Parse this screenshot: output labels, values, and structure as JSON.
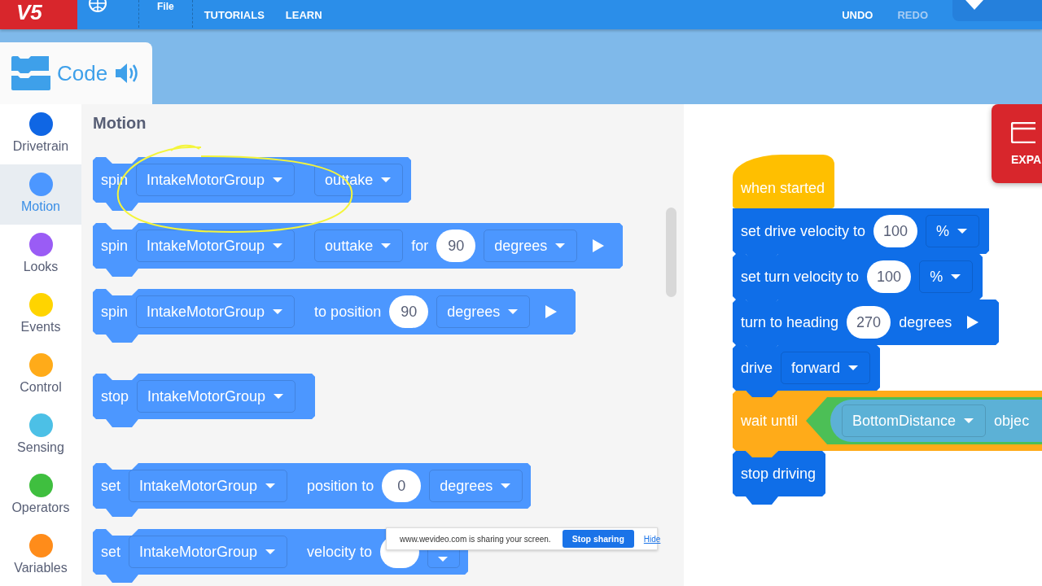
{
  "top_bar": {
    "logo": "V5",
    "file": "File",
    "menu": [
      {
        "label": "TUTORIALS"
      },
      {
        "label": "LEARN"
      }
    ],
    "undo": {
      "label": "UNDO",
      "disabled": false
    },
    "redo": {
      "label": "REDO",
      "disabled": true
    }
  },
  "code_tab": {
    "label": "Code"
  },
  "categories": [
    {
      "label": "Drivetrain",
      "color": "#0f66e4",
      "selected": false
    },
    {
      "label": "Motion",
      "color": "#4c97ff",
      "selected": true
    },
    {
      "label": "Looks",
      "color": "#9a5cf5",
      "selected": false
    },
    {
      "label": "Events",
      "color": "#ffd400",
      "selected": false
    },
    {
      "label": "Control",
      "color": "#ffab19",
      "selected": false
    },
    {
      "label": "Sensing",
      "color": "#4cc0e6",
      "selected": false
    },
    {
      "label": "Operators",
      "color": "#3fbf3f",
      "selected": false
    },
    {
      "label": "Variables",
      "color": "#ff8c1a",
      "selected": false
    }
  ],
  "palette": {
    "heading": "Motion",
    "groups": [
      [
        {
          "kind": "stack",
          "color": "#4c97ff",
          "parts": [
            {
              "kind": "text",
              "text": "spin"
            },
            {
              "kind": "dropdown",
              "text": "IntakeMotorGroup"
            },
            {
              "kind": "dropdown",
              "text": "outtake"
            }
          ]
        },
        {
          "kind": "stack",
          "color": "#4c97ff",
          "parts": [
            {
              "kind": "text",
              "text": "spin"
            },
            {
              "kind": "dropdown",
              "text": "IntakeMotorGroup"
            },
            {
              "kind": "dropdown",
              "text": "outtake"
            },
            {
              "kind": "text",
              "text": "for"
            },
            {
              "kind": "number",
              "text": "90"
            },
            {
              "kind": "dropdown",
              "text": "degrees"
            },
            {
              "kind": "run"
            }
          ]
        },
        {
          "kind": "stack",
          "color": "#4c97ff",
          "parts": [
            {
              "kind": "text",
              "text": "spin"
            },
            {
              "kind": "dropdown",
              "text": "IntakeMotorGroup"
            },
            {
              "kind": "text",
              "text": "to position"
            },
            {
              "kind": "number",
              "text": "90"
            },
            {
              "kind": "dropdown",
              "text": "degrees"
            },
            {
              "kind": "run"
            }
          ]
        }
      ],
      [
        {
          "kind": "stack",
          "color": "#4c97ff",
          "parts": [
            {
              "kind": "text",
              "text": "stop"
            },
            {
              "kind": "dropdown",
              "text": "IntakeMotorGroup"
            }
          ]
        }
      ],
      [
        {
          "kind": "stack",
          "color": "#4c97ff",
          "parts": [
            {
              "kind": "text",
              "text": "set"
            },
            {
              "kind": "dropdown",
              "text": "IntakeMotorGroup"
            },
            {
              "kind": "text",
              "text": "position to"
            },
            {
              "kind": "number",
              "text": "0"
            },
            {
              "kind": "dropdown",
              "text": "degrees"
            }
          ]
        },
        {
          "kind": "stack",
          "color": "#4c97ff",
          "parts": [
            {
              "kind": "text",
              "text": "set"
            },
            {
              "kind": "dropdown",
              "text": "IntakeMotorGroup"
            },
            {
              "kind": "text",
              "text": "velocity to"
            },
            {
              "kind": "number"
            },
            {
              "kind": "dropdown"
            }
          ]
        }
      ]
    ]
  },
  "annotations": [
    {
      "kind": "loop"
    }
  ],
  "workspace": {
    "script": [
      {
        "kind": "hat",
        "color": "#ffbf00",
        "parts": [
          {
            "kind": "text",
            "text": "when started"
          }
        ]
      },
      {
        "kind": "stack",
        "color": "#0f6ee8",
        "parts": [
          {
            "kind": "text",
            "text": "set drive velocity to"
          },
          {
            "kind": "number",
            "text": "100"
          },
          {
            "kind": "dropdown",
            "text": "%"
          }
        ]
      },
      {
        "kind": "stack",
        "color": "#0f6ee8",
        "parts": [
          {
            "kind": "text",
            "text": "set turn velocity to"
          },
          {
            "kind": "number",
            "text": "100"
          },
          {
            "kind": "dropdown",
            "text": "%"
          }
        ]
      },
      {
        "kind": "stack",
        "color": "#0f6ee8",
        "parts": [
          {
            "kind": "text",
            "text": "turn to heading"
          },
          {
            "kind": "number",
            "text": "270"
          },
          {
            "kind": "text",
            "text": "degrees"
          },
          {
            "kind": "run"
          }
        ]
      },
      {
        "kind": "stack",
        "color": "#0f6ee8",
        "parts": [
          {
            "kind": "text",
            "text": "drive"
          },
          {
            "kind": "dropdown",
            "text": "forward"
          }
        ]
      },
      {
        "kind": "wide",
        "color": "#ffab19",
        "parts": [
          {
            "kind": "text",
            "text": "wait until"
          },
          {
            "kind": "boolean",
            "parts": [
              {
                "kind": "reporter",
                "parts": [
                  {
                    "kind": "dropdown",
                    "text": "BottomDistance"
                  },
                  {
                    "kind": "text",
                    "text": "objec"
                  }
                ]
              }
            ]
          }
        ]
      },
      {
        "kind": "stack",
        "color": "#0f6ee8",
        "parts": [
          {
            "kind": "text",
            "text": "stop driving"
          }
        ]
      }
    ],
    "expand_button": {
      "label": "EXPA"
    }
  },
  "share_bar": {
    "message": "www.wevideo.com is sharing your screen.",
    "stop": "Stop sharing",
    "hide": "Hide"
  }
}
